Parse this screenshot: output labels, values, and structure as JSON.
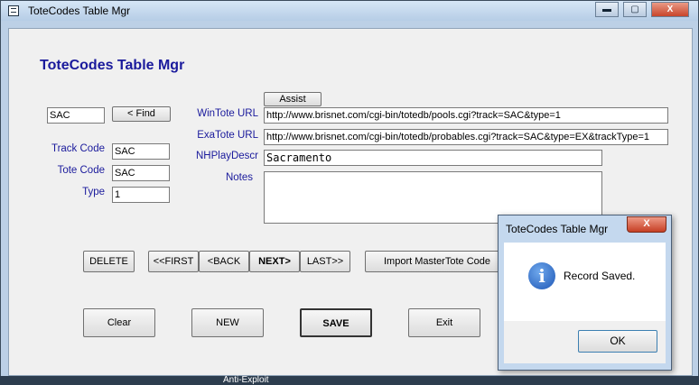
{
  "window": {
    "title": "ToteCodes Table Mgr",
    "minimize": "▬",
    "maximize": "▢",
    "close": "X"
  },
  "form": {
    "heading": "ToteCodes Table Mgr",
    "find_value": "SAC",
    "find_button": "< Find",
    "track_code_label": "Track Code",
    "track_code_value": "SAC",
    "tote_code_label": "Tote Code",
    "tote_code_value": "SAC",
    "type_label": "Type",
    "type_value": "1",
    "assist_button": "Assist",
    "wintote_label": "WinTote URL",
    "wintote_value": "http://www.brisnet.com/cgi-bin/totedb/pools.cgi?track=SAC&type=1",
    "exatote_label": "ExaTote URL",
    "exatote_value": "http://www.brisnet.com/cgi-bin/totedb/probables.cgi?track=SAC&type=EX&trackType=1",
    "nhplay_label": "NHPlayDescr",
    "nhplay_value": "Sacramento",
    "notes_label": "Notes",
    "notes_value": ""
  },
  "nav": {
    "delete": "DELETE",
    "first": "<<FIRST",
    "back": "<BACK",
    "next": "NEXT>",
    "last": "LAST>>",
    "import": "Import MasterTote Code"
  },
  "actions": {
    "clear": "Clear",
    "new": "NEW",
    "save": "SAVE",
    "exit": "Exit"
  },
  "dialog": {
    "title": "ToteCodes Table Mgr",
    "close": "X",
    "icon": "i",
    "message": "Record Saved.",
    "ok": "OK"
  },
  "taskbar": {
    "item": "Anti-Exploit"
  }
}
